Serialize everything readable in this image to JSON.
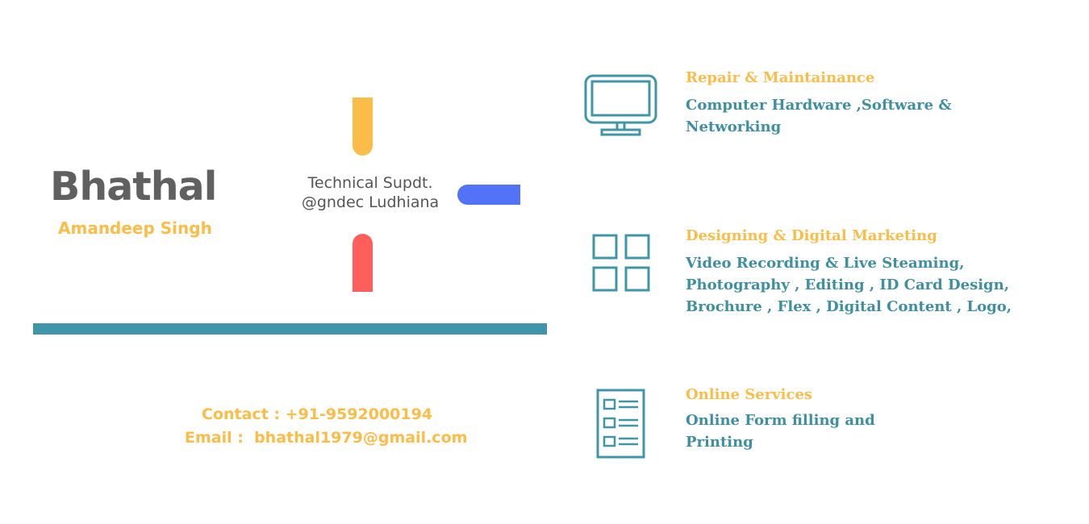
{
  "brand": {
    "name": "Bhathal",
    "person": "Amandeep Singh",
    "role_line1": "Technical Supdt.",
    "role_line2": "@gndec Ludhiana"
  },
  "contact": {
    "phone": "Contact : +91-9592000194",
    "email": "Email :  bhathal1979@gmail.com"
  },
  "services": [
    {
      "icon": "monitor-icon",
      "title": "Repair & Maintainance",
      "description": "Computer Hardware ,Software &\nNetworking"
    },
    {
      "icon": "grid-icon",
      "title": "Designing & Digital Marketing",
      "description": "Video Recording & Live Steaming,\nPhotography , Editing , ID Card Design,\nBrochure , Flex , Digital Content , Logo,"
    },
    {
      "icon": "document-icon",
      "title": "Online Services",
      "description": "Online Form filling and\nPrinting"
    }
  ],
  "colors": {
    "accent_yellow": "#fbbc48",
    "accent_red": "#ff5f5a",
    "accent_blue": "#5272f7",
    "teal": "#3d8fa1",
    "gray": "#606060"
  }
}
